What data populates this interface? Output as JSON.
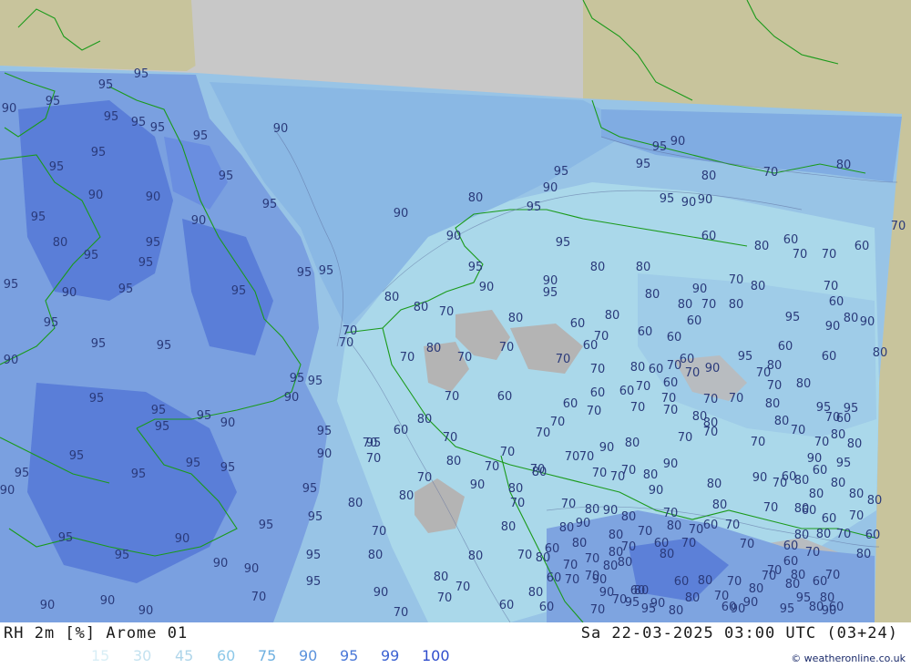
{
  "title_left": "RH 2m [%] Arome 01",
  "title_right": "Sa 22-03-2025 03:00 UTC (03+24)",
  "credit": "© weatheronline.co.uk",
  "legend": [
    {
      "label": "15",
      "color": "#d8eef6"
    },
    {
      "label": "30",
      "color": "#c4e2f0"
    },
    {
      "label": "45",
      "color": "#aed5ea"
    },
    {
      "label": "60",
      "color": "#8cc8e8"
    },
    {
      "label": "75",
      "color": "#6eb0e0"
    },
    {
      "label": "90",
      "color": "#5a92dc"
    },
    {
      "label": "95",
      "color": "#4a78d8"
    },
    {
      "label": "99",
      "color": "#3c62d2"
    },
    {
      "label": "100",
      "color": "#2e4ccc"
    }
  ],
  "colors": {
    "background_outside": "#c8c8c8",
    "land_outside": "#c8c49c",
    "rh_60": "#b4b4b4",
    "rh_70": "#a8d8e8",
    "rh_80": "#98c4e6",
    "rh_90": "#88b4e4",
    "rh_95": "#6c94e0",
    "rh_99": "#5878d8",
    "coastline": "#1a9a1a",
    "contour_text": "#2a3a7a"
  },
  "contour_labels": [
    "95",
    "95",
    "95",
    "90",
    "95",
    "95",
    "95",
    "95",
    "90",
    "95",
    "95",
    "90",
    "95",
    "95",
    "90",
    "95",
    "90",
    "95",
    "95",
    "80",
    "95",
    "95",
    "90",
    "95",
    "95",
    "95",
    "95",
    "95",
    "95",
    "95",
    "90",
    "95",
    "95",
    "90",
    "95",
    "95",
    "95",
    "95",
    "90",
    "95",
    "95",
    "90",
    "95",
    "95",
    "95",
    "95",
    "95",
    "90",
    "95",
    "95",
    "95",
    "90",
    "95",
    "95",
    "90",
    "90",
    "95",
    "95",
    "90",
    "90",
    "90",
    "90",
    "90",
    "80",
    "90",
    "95",
    "90",
    "95",
    "95",
    "95",
    "90",
    "90",
    "95",
    "80",
    "80",
    "80",
    "80",
    "80",
    "70",
    "80",
    "70",
    "70",
    "70",
    "80",
    "70",
    "70",
    "60",
    "80",
    "60",
    "70",
    "60",
    "60",
    "70",
    "60",
    "60",
    "70",
    "60",
    "60",
    "60",
    "60",
    "60",
    "70",
    "70",
    "80",
    "70",
    "70",
    "70",
    "70",
    "70",
    "70",
    "80",
    "70",
    "60",
    "70",
    "70",
    "70",
    "70",
    "70",
    "70",
    "80",
    "70",
    "80",
    "80",
    "70",
    "80",
    "70",
    "70",
    "80",
    "90",
    "80",
    "90",
    "70",
    "80",
    "70",
    "70",
    "80",
    "80",
    "90",
    "80",
    "70",
    "70",
    "80",
    "90",
    "80",
    "70",
    "80",
    "80",
    "80",
    "80",
    "70",
    "80",
    "80",
    "90",
    "80",
    "70",
    "80",
    "70",
    "60",
    "70",
    "60",
    "70",
    "80",
    "80",
    "70",
    "60",
    "70",
    "70",
    "80",
    "70",
    "60",
    "80",
    "70",
    "70",
    "80",
    "80",
    "70",
    "60",
    "80",
    "70",
    "80",
    "60",
    "70",
    "70",
    "80",
    "60",
    "60",
    "80",
    "70",
    "70",
    "80",
    "70",
    "70",
    "60",
    "60",
    "70",
    "70",
    "80",
    "90",
    "80",
    "70",
    "90",
    "90",
    "95",
    "95",
    "90",
    "80",
    "80",
    "70",
    "70",
    "60",
    "80",
    "60",
    "80",
    "70",
    "60",
    "80",
    "60",
    "70",
    "80",
    "70",
    "80",
    "60",
    "90",
    "95",
    "95",
    "80",
    "80",
    "70",
    "95",
    "90",
    "70",
    "70",
    "60",
    "60",
    "90",
    "95",
    "80",
    "90",
    "80",
    "60",
    "70",
    "80",
    "70",
    "90",
    "80",
    "70",
    "80",
    "60",
    "80",
    "70",
    "70",
    "60",
    "60",
    "60",
    "90",
    "90",
    "95",
    "95",
    "95",
    "90",
    "80",
    "70",
    "80",
    "70",
    "70",
    "80",
    "70",
    "90",
    "70",
    "90",
    "70",
    "80",
    "60",
    "80",
    "80",
    "70",
    "60",
    "80",
    "80",
    "70",
    "60",
    "80",
    "70",
    "80",
    "70",
    "80",
    "60",
    "95",
    "90",
    "90",
    "95",
    "95"
  ]
}
